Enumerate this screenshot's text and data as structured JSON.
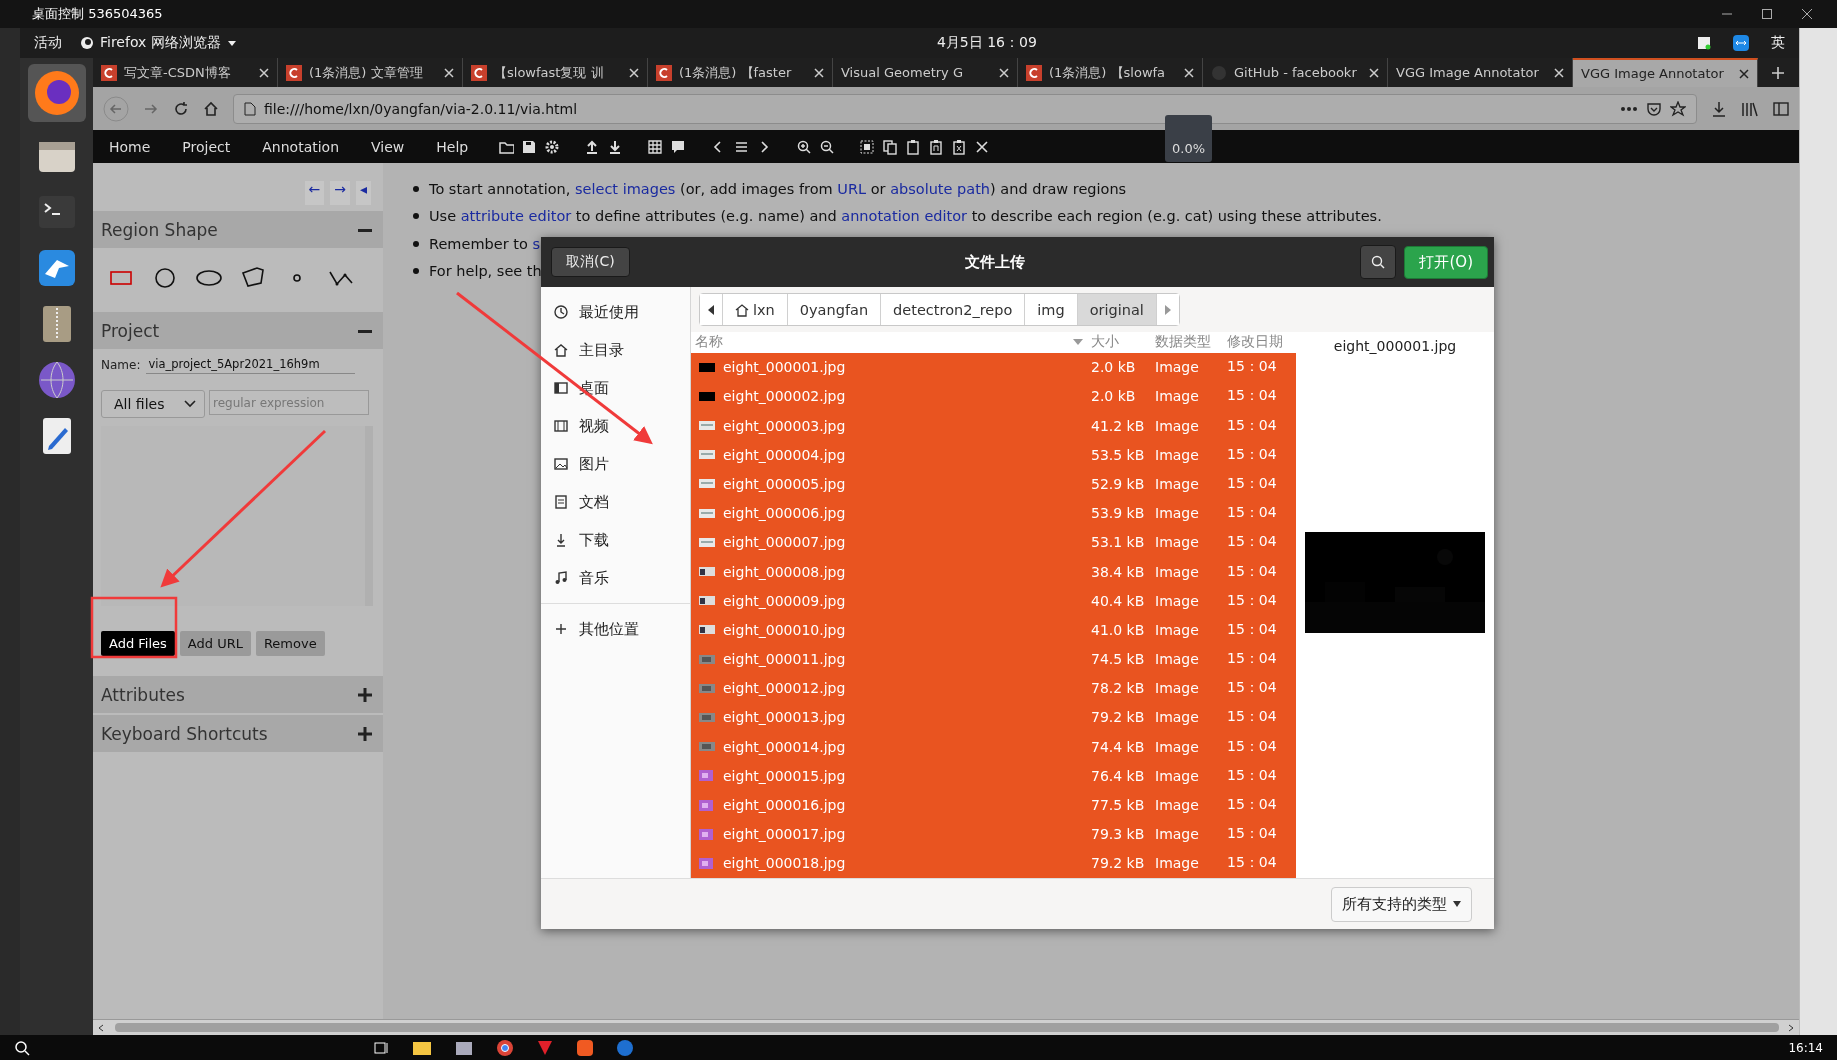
{
  "remote_window": {
    "title": "桌面控制 536504365"
  },
  "top_bar": {
    "activities": "活动",
    "app_menu": "Firefox 网络浏览器",
    "clock": "4月5日 16：09",
    "input_method": "英"
  },
  "tabs": [
    {
      "label": "写文章-CSDN博客",
      "kind": "csdn",
      "selected": false
    },
    {
      "label": "(1条消息) 文章管理",
      "kind": "csdn",
      "selected": false
    },
    {
      "label": "【slowfast复现 训",
      "kind": "csdn",
      "selected": false
    },
    {
      "label": "(1条消息) 【faster",
      "kind": "csdn",
      "selected": false
    },
    {
      "label": "Visual Geometry G",
      "kind": "plain",
      "selected": false
    },
    {
      "label": "(1条消息) 【slowfa",
      "kind": "csdn",
      "selected": false
    },
    {
      "label": "GitHub - facebookr",
      "kind": "github",
      "selected": false
    },
    {
      "label": "VGG Image Annotator",
      "kind": "plain",
      "selected": false
    },
    {
      "label": "VGG Image Annotator",
      "kind": "plain",
      "selected": true
    }
  ],
  "url": "file:///home/lxn/0yangfan/via-2.0.11/via.html",
  "via": {
    "menu": [
      "Home",
      "Project",
      "Annotation",
      "View",
      "Help"
    ],
    "progress": "0.0%",
    "panel_nav": [
      "←",
      "→",
      "◂"
    ],
    "sections": [
      {
        "title": "Region Shape",
        "expanded": true
      },
      {
        "title": "Project",
        "expanded": true
      },
      {
        "title": "Attributes",
        "expanded": false
      },
      {
        "title": "Keyboard Shortcuts",
        "expanded": false
      }
    ],
    "shapes": [
      {
        "kind": "rectangle",
        "selected": true
      },
      {
        "kind": "circle",
        "selected": false
      },
      {
        "kind": "ellipse",
        "selected": false
      },
      {
        "kind": "polygon",
        "selected": false
      },
      {
        "kind": "point",
        "selected": false
      },
      {
        "kind": "polyline",
        "selected": false
      }
    ],
    "project": {
      "name_label": "Name:",
      "name": "via_project_5Apr2021_16h9m",
      "filter_select": "All files",
      "filter_placeholder": "regular expression",
      "buttons": [
        {
          "label": "Add Files",
          "selected": true
        },
        {
          "label": "Add URL",
          "selected": false
        },
        {
          "label": "Remove",
          "selected": false
        }
      ]
    },
    "help": [
      [
        {
          "text": "To start annotation, "
        },
        {
          "text": "select images",
          "link": true
        },
        {
          "text": " (or, add images from "
        },
        {
          "text": "URL",
          "link": true
        },
        {
          "text": " or "
        },
        {
          "text": "absolute path",
          "link": true
        },
        {
          "text": ") and draw regions"
        }
      ],
      [
        {
          "text": "Use "
        },
        {
          "text": "attribute editor",
          "link": true
        },
        {
          "text": " to define attributes (e.g. name) and "
        },
        {
          "text": "annotation editor",
          "link": true
        },
        {
          "text": " to describe each region (e.g. cat) using these attributes."
        }
      ],
      [
        {
          "text": "Remember to "
        },
        {
          "text": "s",
          "link": true
        }
      ],
      [
        {
          "text": "For help, see th"
        }
      ]
    ]
  },
  "dialog": {
    "cancel": "取消(C)",
    "title": "文件上传",
    "open": "打开(O)",
    "places": [
      {
        "kind": "recent",
        "label": "最近使用"
      },
      {
        "kind": "home",
        "label": "主目录"
      },
      {
        "kind": "desktop",
        "label": "桌面"
      },
      {
        "kind": "video",
        "label": "视频"
      },
      {
        "kind": "pictures",
        "label": "图片"
      },
      {
        "kind": "documents",
        "label": "文档"
      },
      {
        "kind": "downloads",
        "label": "下载"
      },
      {
        "kind": "music",
        "label": "音乐"
      },
      {
        "kind": "other",
        "label": "其他位置"
      }
    ],
    "path": [
      {
        "kind": "home",
        "label": "lxn",
        "selected": false
      },
      {
        "kind": "folder",
        "label": "0yangfan",
        "selected": false
      },
      {
        "kind": "folder",
        "label": "detectron2_repo",
        "selected": false
      },
      {
        "kind": "folder",
        "label": "img",
        "selected": false
      },
      {
        "kind": "folder",
        "label": "original",
        "selected": true
      }
    ],
    "columns": [
      "名称",
      "大小",
      "数据类型",
      "修改日期"
    ],
    "files": [
      {
        "name": "eight_000001.jpg",
        "size": "2.0 kB",
        "type": "Image",
        "modified": "15：04",
        "kind": "black",
        "selected": true
      },
      {
        "name": "eight_000002.jpg",
        "size": "2.0 kB",
        "type": "Image",
        "modified": "15：04",
        "kind": "black",
        "selected": true
      },
      {
        "name": "eight_000003.jpg",
        "size": "41.2 kB",
        "type": "Image",
        "modified": "15：04",
        "kind": "light",
        "selected": true
      },
      {
        "name": "eight_000004.jpg",
        "size": "53.5 kB",
        "type": "Image",
        "modified": "15：04",
        "kind": "light",
        "selected": true
      },
      {
        "name": "eight_000005.jpg",
        "size": "52.9 kB",
        "type": "Image",
        "modified": "15：04",
        "kind": "light",
        "selected": true
      },
      {
        "name": "eight_000006.jpg",
        "size": "53.9 kB",
        "type": "Image",
        "modified": "15：04",
        "kind": "light",
        "selected": true
      },
      {
        "name": "eight_000007.jpg",
        "size": "53.1 kB",
        "type": "Image",
        "modified": "15：04",
        "kind": "light",
        "selected": true
      },
      {
        "name": "eight_000008.jpg",
        "size": "38.4 kB",
        "type": "Image",
        "modified": "15：04",
        "selected": true
      },
      {
        "name": "eight_000009.jpg",
        "size": "40.4 kB",
        "type": "Image",
        "modified": "15：04",
        "selected": true
      },
      {
        "name": "eight_000010.jpg",
        "size": "41.0 kB",
        "type": "Image",
        "modified": "15：04",
        "selected": true
      },
      {
        "name": "eight_000011.jpg",
        "size": "74.5 kB",
        "type": "Image",
        "modified": "15：04",
        "kind": "grey",
        "selected": true
      },
      {
        "name": "eight_000012.jpg",
        "size": "78.2 kB",
        "type": "Image",
        "modified": "15：04",
        "kind": "grey",
        "selected": true
      },
      {
        "name": "eight_000013.jpg",
        "size": "79.2 kB",
        "type": "Image",
        "modified": "15：04",
        "kind": "grey",
        "selected": true
      },
      {
        "name": "eight_000014.jpg",
        "size": "74.4 kB",
        "type": "Image",
        "modified": "15：04",
        "kind": "grey",
        "selected": true
      },
      {
        "name": "eight_000015.jpg",
        "size": "76.4 kB",
        "type": "Image",
        "modified": "15：04",
        "kind": "purple",
        "selected": true
      },
      {
        "name": "eight_000016.jpg",
        "size": "77.5 kB",
        "type": "Image",
        "modified": "15：04",
        "kind": "purple",
        "selected": true
      },
      {
        "name": "eight_000017.jpg",
        "size": "79.3 kB",
        "type": "Image",
        "modified": "15：04",
        "kind": "purple",
        "selected": true
      },
      {
        "name": "eight_000018.jpg",
        "size": "79.2 kB",
        "type": "Image",
        "modified": "15：04",
        "kind": "purple",
        "selected": true
      }
    ],
    "preview": {
      "caption": "eight_000001.jpg"
    },
    "file_type": "所有支持的类型"
  },
  "taskbar": {
    "clock": "16:14"
  }
}
